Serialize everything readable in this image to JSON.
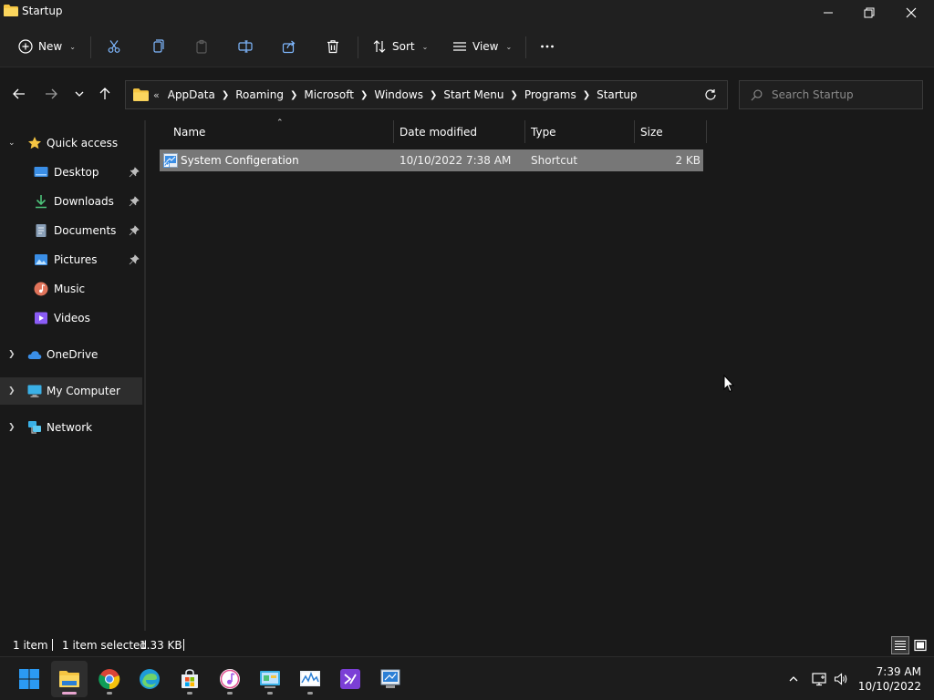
{
  "window": {
    "title": "Startup"
  },
  "toolbar": {
    "new_label": "New",
    "sort_label": "Sort",
    "view_label": "View"
  },
  "address": {
    "overflow": "«",
    "crumbs": [
      "AppData",
      "Roaming",
      "Microsoft",
      "Windows",
      "Start Menu",
      "Programs",
      "Startup"
    ]
  },
  "search": {
    "placeholder": "Search Startup"
  },
  "nav": {
    "quick_access": "Quick access",
    "items": [
      {
        "label": "Desktop",
        "pinned": true
      },
      {
        "label": "Downloads",
        "pinned": true
      },
      {
        "label": "Documents",
        "pinned": true
      },
      {
        "label": "Pictures",
        "pinned": true
      },
      {
        "label": "Music",
        "pinned": false
      },
      {
        "label": "Videos",
        "pinned": false
      }
    ],
    "onedrive": "OneDrive",
    "my_computer": "My Computer",
    "network": "Network"
  },
  "columns": {
    "name": "Name",
    "date_modified": "Date modified",
    "type": "Type",
    "size": "Size"
  },
  "files": [
    {
      "name": "System Configeration",
      "date_modified": "10/10/2022 7:38 AM",
      "type": "Shortcut",
      "size": "2 KB"
    }
  ],
  "status": {
    "count": "1 item",
    "selected": "1 item selected",
    "size": "1.33 KB"
  },
  "clock": {
    "time": "7:39 AM",
    "date": "10/10/2022"
  },
  "colors": {
    "accent": "#0078d4",
    "folder": "#f5c542",
    "selection": "#777777"
  }
}
